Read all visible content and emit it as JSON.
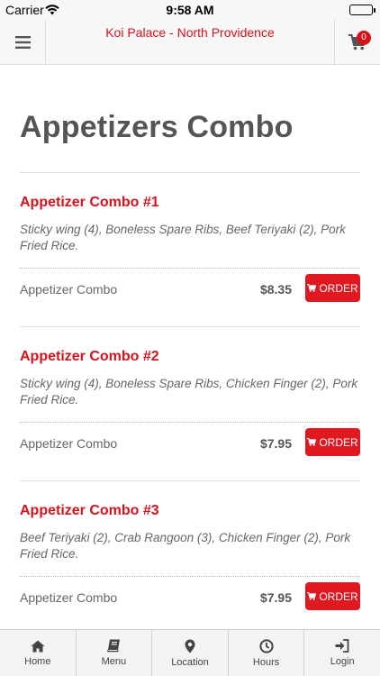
{
  "status_bar": {
    "carrier": "Carrier",
    "time": "9:58 AM"
  },
  "header": {
    "title": "Koi Palace - North Providence",
    "cart_count": "0"
  },
  "category": {
    "title": "Appetizers Combo"
  },
  "items": [
    {
      "name": "Appetizer Combo #1",
      "description": "Sticky wing (4), Boneless Spare Ribs, Beef Teriyaki (2), Pork Fried Rice.",
      "size_label": "Appetizer Combo",
      "price": "$8.35",
      "order_label": "ORDER"
    },
    {
      "name": "Appetizer Combo #2",
      "description": "Sticky wing (4), Boneless Spare Ribs, Chicken Finger (2), Pork Fried Rice.",
      "size_label": "Appetizer Combo",
      "price": "$7.95",
      "order_label": "ORDER"
    },
    {
      "name": "Appetizer Combo #3",
      "description": "Beef Teriyaki (2), Crab Rangoon (3), Chicken Finger (2), Pork Fried Rice.",
      "size_label": "Appetizer Combo",
      "price": "$7.95",
      "order_label": "ORDER"
    }
  ],
  "tabbar": [
    {
      "label": "Home",
      "icon": "home-icon"
    },
    {
      "label": "Menu",
      "icon": "book-icon"
    },
    {
      "label": "Location",
      "icon": "map-pin-icon"
    },
    {
      "label": "Hours",
      "icon": "clock-icon"
    },
    {
      "label": "Login",
      "icon": "login-icon"
    }
  ],
  "colors": {
    "accent": "#d8121b",
    "order_button": "#e01820",
    "text": "#555555"
  }
}
